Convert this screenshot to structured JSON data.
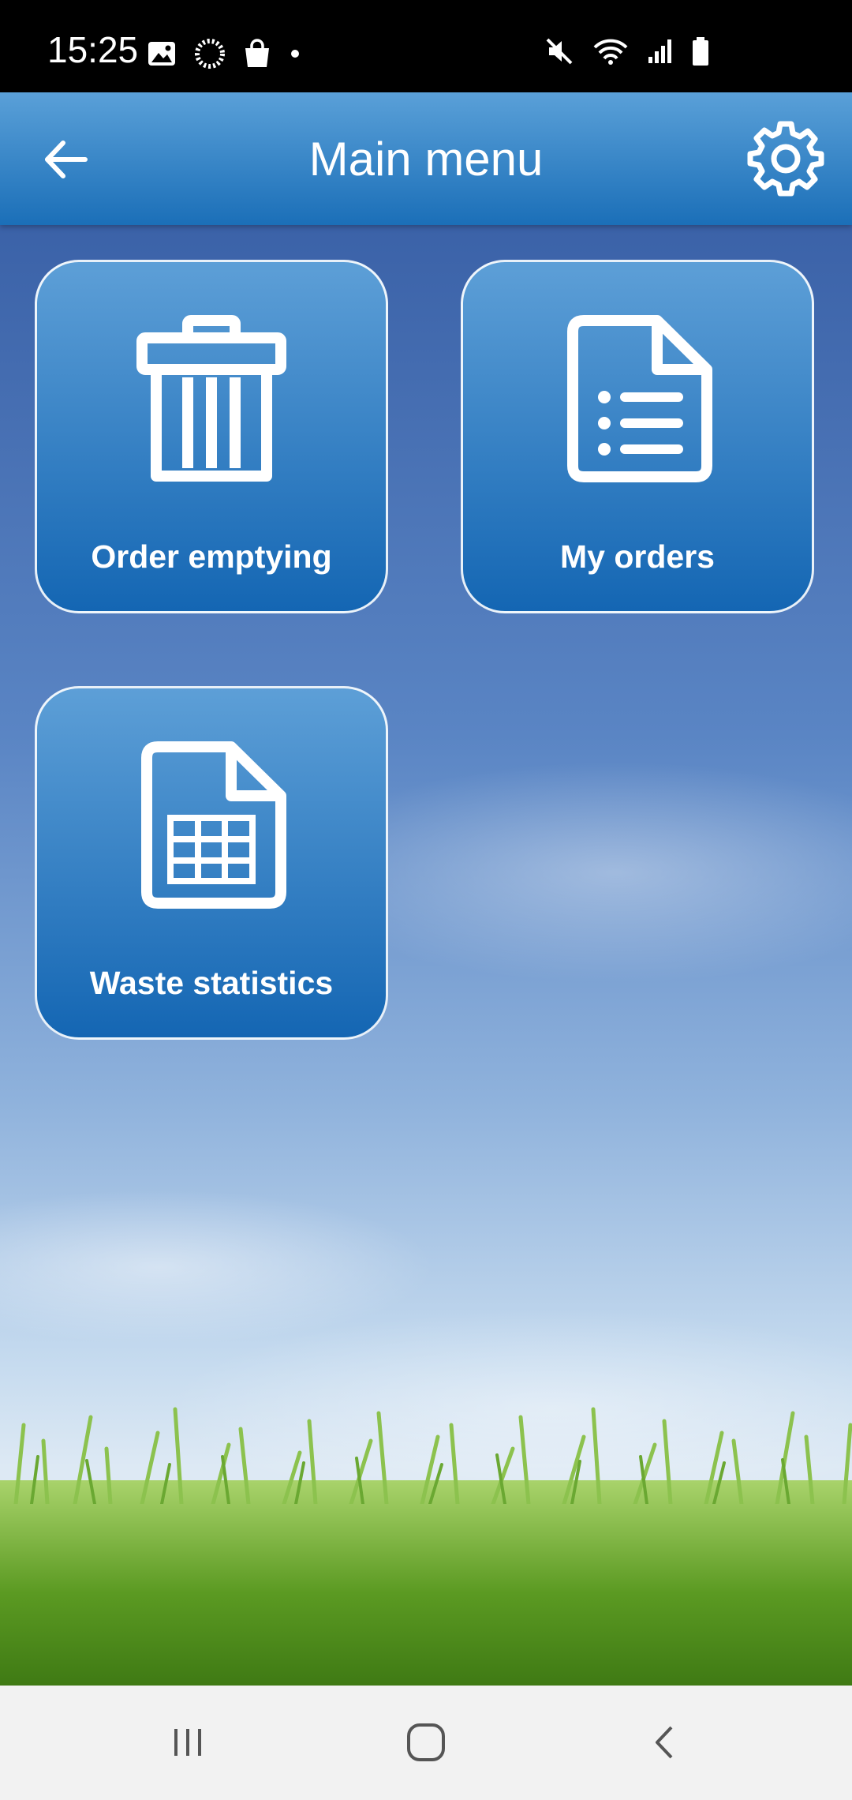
{
  "status_bar": {
    "time": "15:25",
    "left_icons": [
      "image-icon",
      "loading-icon",
      "shopping-bag-icon",
      "dot-icon"
    ],
    "right_icons": [
      "mute-icon",
      "wifi-icon",
      "signal-icon",
      "battery-icon"
    ]
  },
  "app_bar": {
    "title": "Main menu",
    "back_icon": "arrow-left-icon",
    "settings_icon": "gear-icon",
    "color": "#2a7cc2"
  },
  "tiles": [
    {
      "label": "Order emptying",
      "icon": "trash-can-icon"
    },
    {
      "label": "My orders",
      "icon": "document-list-icon"
    },
    {
      "label": "Waste statistics",
      "icon": "spreadsheet-icon"
    }
  ],
  "nav_bar": {
    "buttons": [
      "recent-apps-icon",
      "home-icon",
      "back-icon"
    ]
  }
}
